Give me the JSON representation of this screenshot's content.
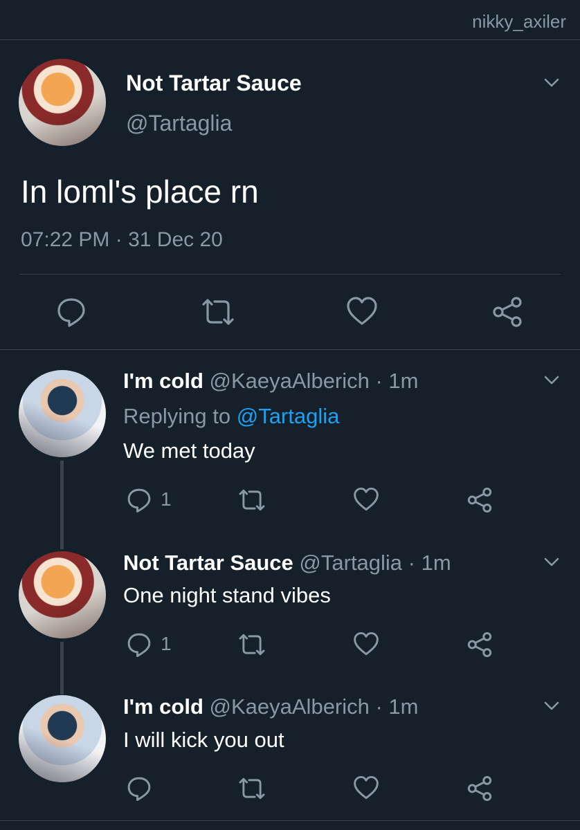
{
  "watermark": "nikky_axiler",
  "main_tweet": {
    "display_name": "Not Tartar Sauce",
    "handle": "@Tartaglia",
    "text": "In loml's place rn",
    "timestamp": "07:22 PM · 31 Dec 20"
  },
  "replies": [
    {
      "display_name": "I'm cold",
      "meta": "@KaeyaAlberich · 1m",
      "replying_prefix": "Replying to",
      "replying_handle": "@Tartaglia",
      "text": "We met today",
      "reply_count": "1"
    },
    {
      "display_name": "Not Tartar Sauce",
      "meta": "@Tartaglia · 1m",
      "text": "One night stand vibes",
      "reply_count": "1"
    },
    {
      "display_name": "I'm cold",
      "meta": "@KaeyaAlberich · 1m",
      "text": "I will kick you out"
    }
  ],
  "colors": {
    "background": "#15202b",
    "secondary_text": "#8899a6",
    "link": "#1da1f2",
    "divider": "#38444d"
  },
  "icons": [
    "chevron-down-icon",
    "reply-icon",
    "retweet-icon",
    "like-icon",
    "share-icon"
  ]
}
